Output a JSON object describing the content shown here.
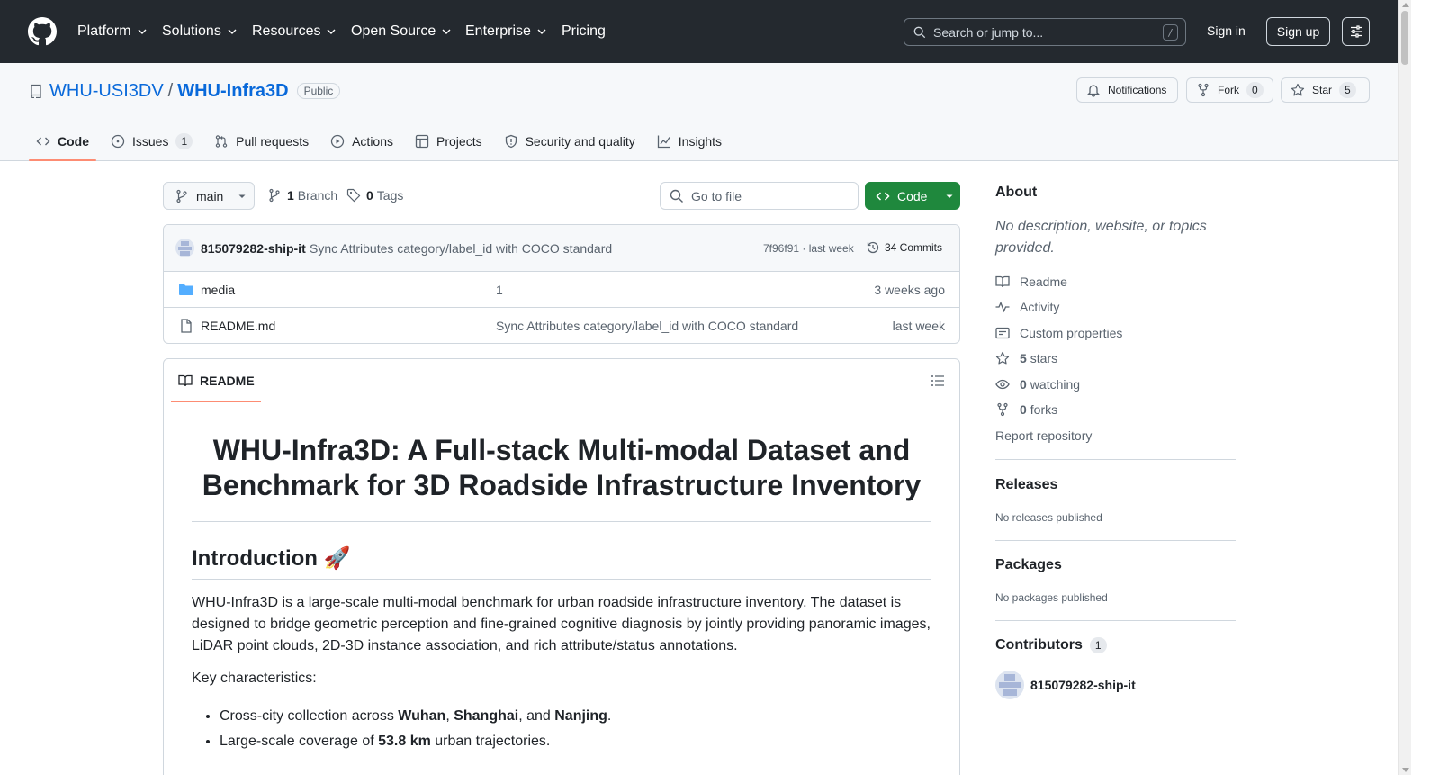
{
  "colors": {
    "header_bg": "#24292f",
    "link": "#0969da",
    "primary_green": "#1f883d",
    "tab_underline": "#fd8c73",
    "border": "#d0d7de",
    "muted": "#59636e"
  },
  "header": {
    "nav": [
      {
        "label": "Platform",
        "icon": "chevron-down-icon"
      },
      {
        "label": "Solutions",
        "icon": "chevron-down-icon"
      },
      {
        "label": "Resources",
        "icon": "chevron-down-icon"
      },
      {
        "label": "Open Source",
        "icon": "chevron-down-icon"
      },
      {
        "label": "Enterprise",
        "icon": "chevron-down-icon"
      },
      {
        "label": "Pricing"
      }
    ],
    "search_placeholder": "Search or jump to...",
    "search_key": "/",
    "sign_in": "Sign in",
    "sign_up": "Sign up"
  },
  "repo": {
    "owner": "WHU-USI3DV",
    "separator": "/",
    "name": "WHU-Infra3D",
    "visibility": "Public",
    "notifications_label": "Notifications",
    "fork_label": "Fork",
    "fork_count": "0",
    "star_label": "Star",
    "star_count": "5",
    "tabs": [
      {
        "label": "Code",
        "icon": "code-icon",
        "active": true
      },
      {
        "label": "Issues",
        "icon": "issue-opened-icon",
        "count": "1"
      },
      {
        "label": "Pull requests",
        "icon": "git-pull-request-icon"
      },
      {
        "label": "Actions",
        "icon": "play-icon"
      },
      {
        "label": "Projects",
        "icon": "table-icon"
      },
      {
        "label": "Security and quality",
        "icon": "shield-icon"
      },
      {
        "label": "Insights",
        "icon": "graph-icon"
      }
    ]
  },
  "filebar": {
    "branch": "main",
    "branch_count": "1",
    "branch_label": "Branch",
    "tag_count": "0",
    "tag_label": "Tags",
    "goto_placeholder": "Go to file",
    "code_button": "Code"
  },
  "latest_commit": {
    "author": "815079282-ship-it",
    "message": "Sync Attributes category/label_id with COCO standard",
    "hash_time": "7f96f91 · last week",
    "commits": "34 Commits"
  },
  "files": [
    {
      "type": "folder",
      "name": "media",
      "message": "1",
      "date": "3 weeks ago"
    },
    {
      "type": "file",
      "name": "README.md",
      "message": "Sync Attributes category/label_id with COCO standard",
      "date": "last week"
    }
  ],
  "readme": {
    "tab_label": "README",
    "title": "WHU-Infra3D: A Full-stack Multi-modal Dataset and Benchmark for 3D Roadside Infrastructure Inventory",
    "intro_heading": "Introduction 🚀",
    "intro_paragraph": "WHU-Infra3D is a large-scale multi-modal benchmark for urban roadside infrastructure inventory. The dataset is designed to bridge geometric perception and fine-grained cognitive diagnosis by jointly providing panoramic images, LiDAR point clouds, 2D-3D instance association, and rich attribute/status annotations.",
    "key_label": "Key characteristics:",
    "bullet1": {
      "before": "Cross-city collection across ",
      "city1": "Wuhan",
      "comma1": ", ",
      "city2": "Shanghai",
      "comma2": ", and ",
      "city3": "Nanjing",
      "end": "."
    },
    "bullet2": {
      "before": "Large-scale coverage of ",
      "bold": "53.8 km",
      "after": " urban trajectories."
    }
  },
  "sidebar": {
    "about_heading": "About",
    "about_desc": "No description, website, or topics provided.",
    "readme": "Readme",
    "activity": "Activity",
    "custom_props": "Custom properties",
    "stars_count": "5",
    "stars_label": "stars",
    "watching_count": "0",
    "watching_label": "watching",
    "forks_count": "0",
    "forks_label": "forks",
    "report": "Report repository",
    "releases_heading": "Releases",
    "releases_text": "No releases published",
    "packages_heading": "Packages",
    "packages_text": "No packages published",
    "contributors_heading": "Contributors",
    "contributors_count": "1",
    "contributor_name": "815079282-ship-it"
  }
}
